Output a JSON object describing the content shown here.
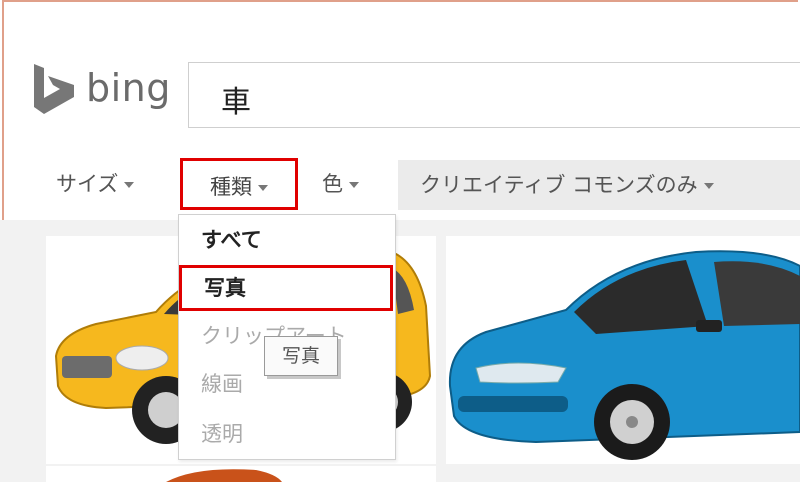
{
  "brand": {
    "name": "bing",
    "logo_color": "#777777"
  },
  "search": {
    "value": "車"
  },
  "filters": {
    "size": "サイズ",
    "type": "種類",
    "color": "色",
    "license": "クリエイティブ コモンズのみ"
  },
  "type_menu": {
    "items": [
      "すべて",
      "写真",
      "クリップアート",
      "線画",
      "透明"
    ],
    "selected": "写真"
  },
  "tooltip": {
    "text": "写真"
  },
  "accent": {
    "highlight_border": "#e00000",
    "yellow_car": "#f6b81e",
    "blue_car": "#1a8fcc"
  }
}
